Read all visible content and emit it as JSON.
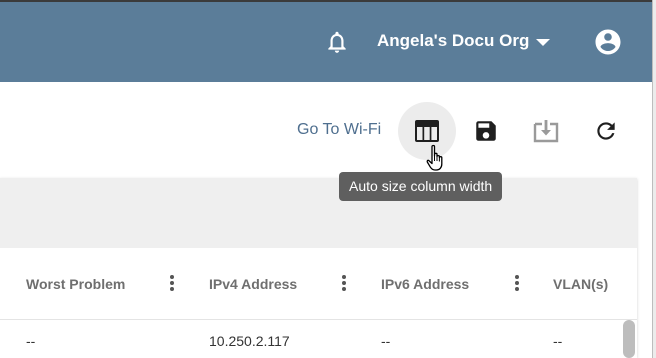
{
  "header": {
    "org_name": "Angela's Docu Org",
    "bg_color": "#5b7d99",
    "icons": {
      "bell": "bell-icon",
      "caret": "chevron-down-icon",
      "account": "account-circle-icon"
    }
  },
  "toolbar": {
    "goto_label": "Go To Wi-Fi",
    "tooltip": "Auto size column width",
    "buttons": [
      "auto-size-columns-icon",
      "save-icon",
      "export-icon",
      "refresh-icon"
    ]
  },
  "table": {
    "columns": [
      "Worst Problem",
      "IPv4 Address",
      "IPv6 Address",
      "VLAN(s)"
    ],
    "rows": [
      [
        "--",
        "10.250.2.117",
        "--",
        "--"
      ]
    ]
  }
}
